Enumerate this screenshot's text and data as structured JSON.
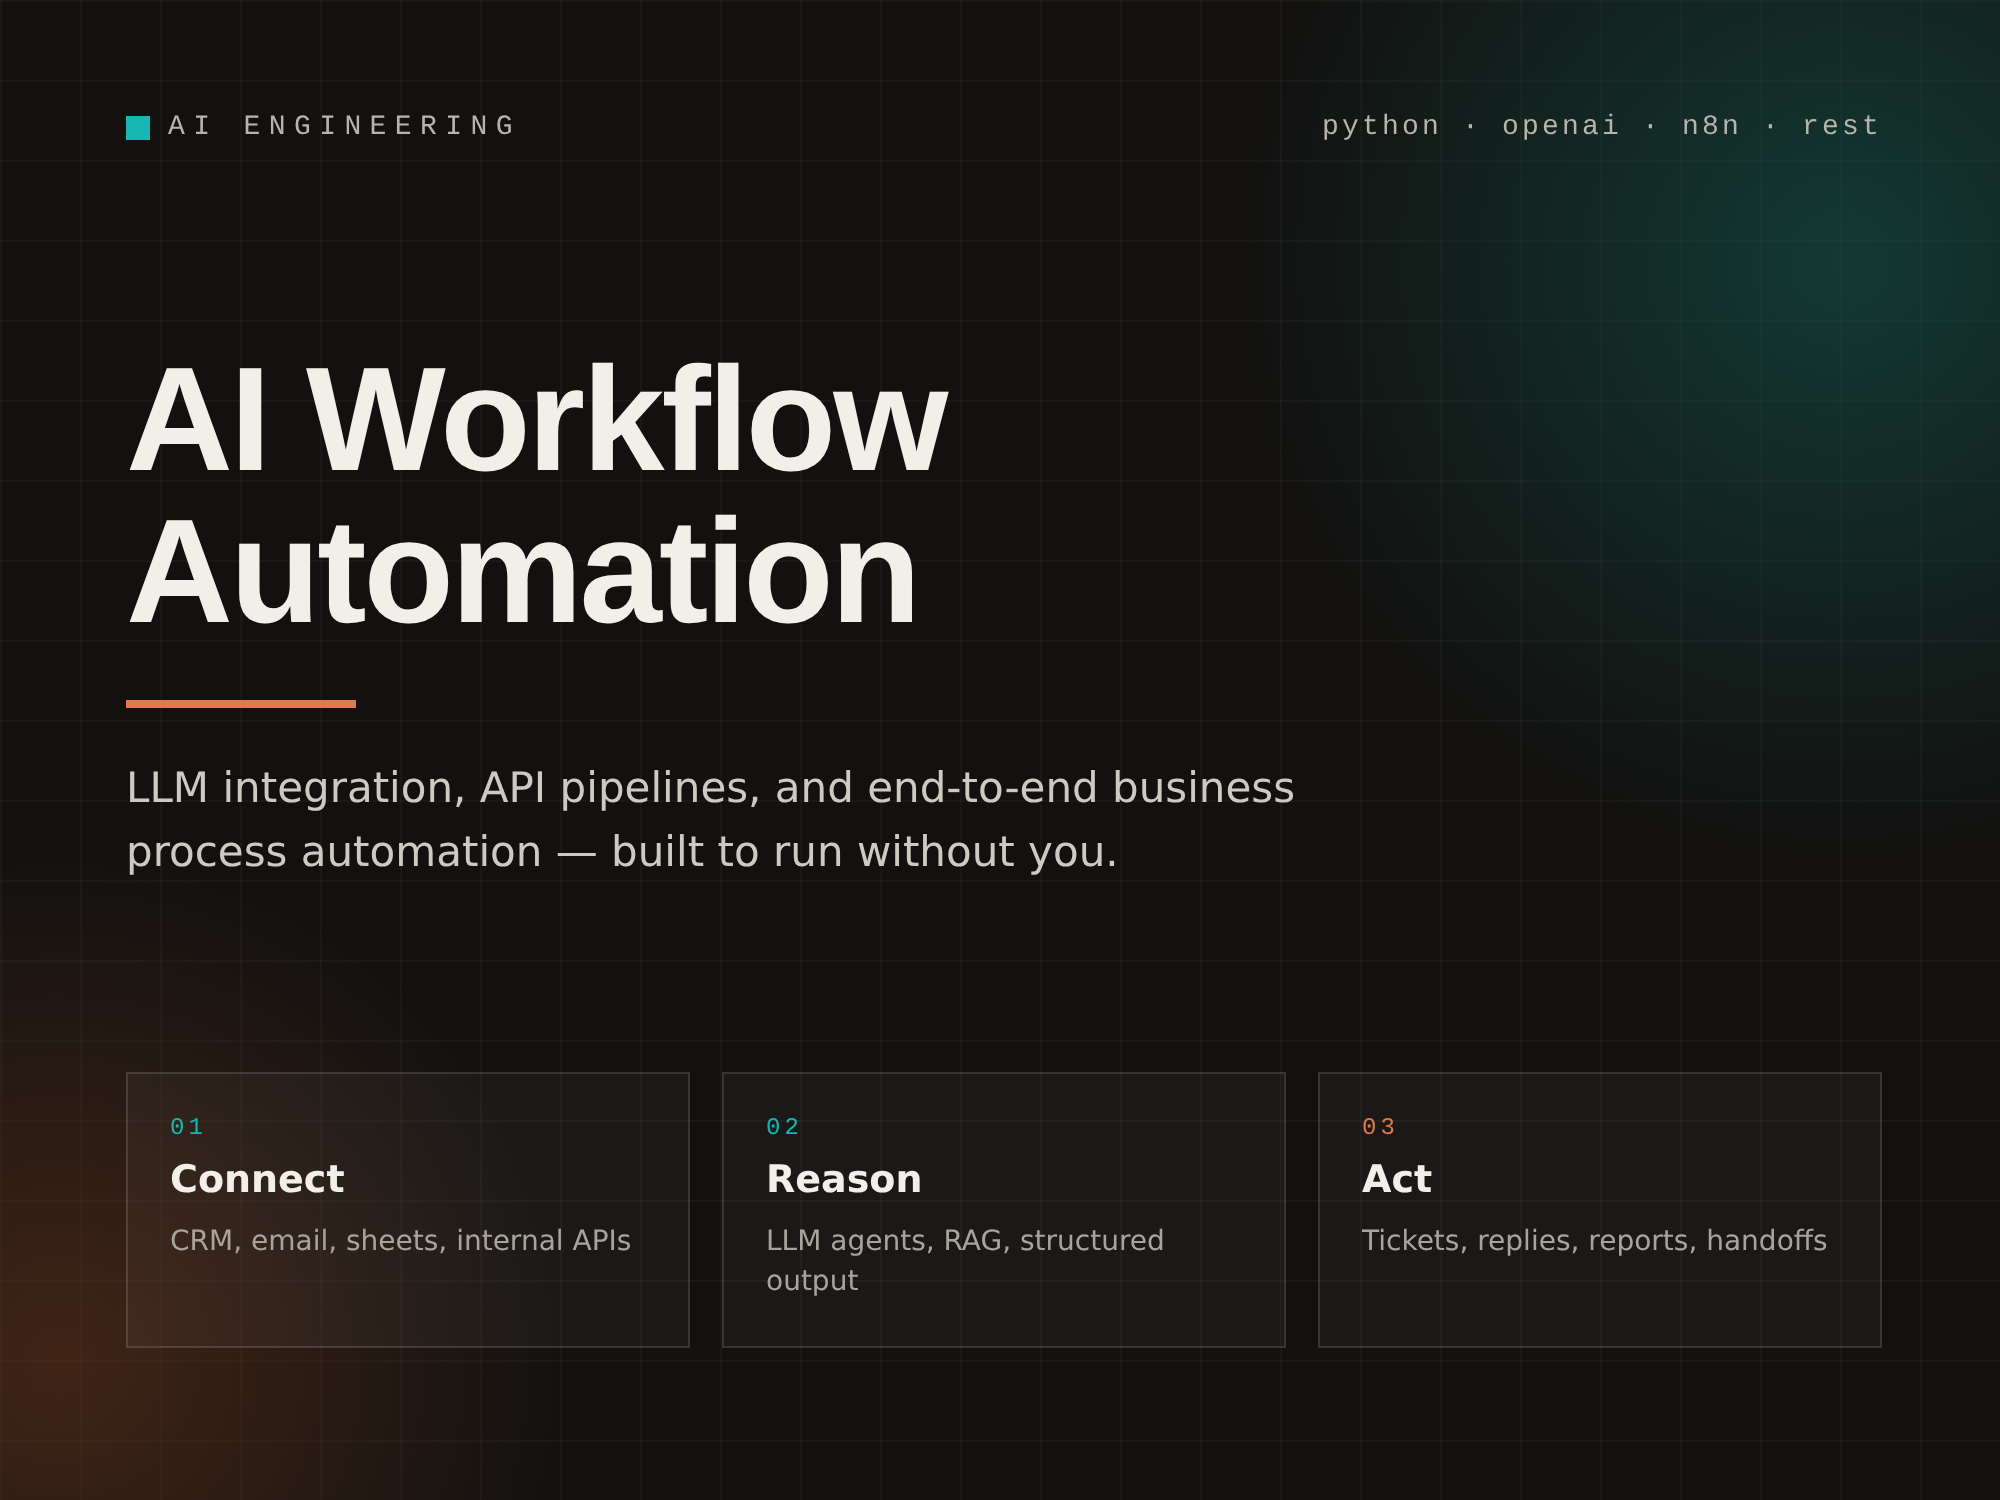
{
  "header": {
    "label": "AI ENGINEERING",
    "tags": "python · openai · n8n · rest"
  },
  "hero": {
    "title_lines": [
      "AI Workflow",
      "Automation"
    ],
    "subtitle": "LLM integration, API pipelines, and end-to-end business process automation — built to run without you."
  },
  "cards": [
    {
      "number": "01",
      "color": "#14b8b0",
      "title": "Connect",
      "text": "CRM, email, sheets, internal APIs"
    },
    {
      "number": "02",
      "color": "#14b8b0",
      "title": "Reason",
      "text": "LLM agents, RAG, structured output"
    },
    {
      "number": "03",
      "color": "#e07a4a",
      "title": "Act",
      "text": "Tickets, replies, reports, handoffs"
    }
  ]
}
